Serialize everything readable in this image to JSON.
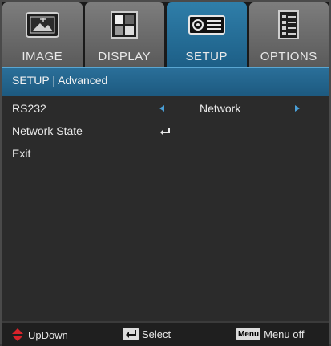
{
  "tabs": [
    {
      "label": "IMAGE",
      "icon": "image-icon",
      "active": false
    },
    {
      "label": "DISPLAY",
      "icon": "display-icon",
      "active": false
    },
    {
      "label": "SETUP",
      "icon": "projector-icon",
      "active": true
    },
    {
      "label": "OPTIONS",
      "icon": "options-icon",
      "active": false
    }
  ],
  "title": "SETUP | Advanced",
  "rows": {
    "rs232": {
      "label": "RS232",
      "value": "Network"
    },
    "network_state": {
      "label": "Network State"
    },
    "exit": {
      "label": "Exit"
    }
  },
  "footer": {
    "updown_label": "UpDown",
    "select_label": "Select",
    "menu_key": "Menu",
    "menu_label": "Menu off"
  },
  "colors": {
    "accent": "#1d5f87",
    "arrow": "#4aa0d8",
    "updown_icon": "#d9232a"
  }
}
